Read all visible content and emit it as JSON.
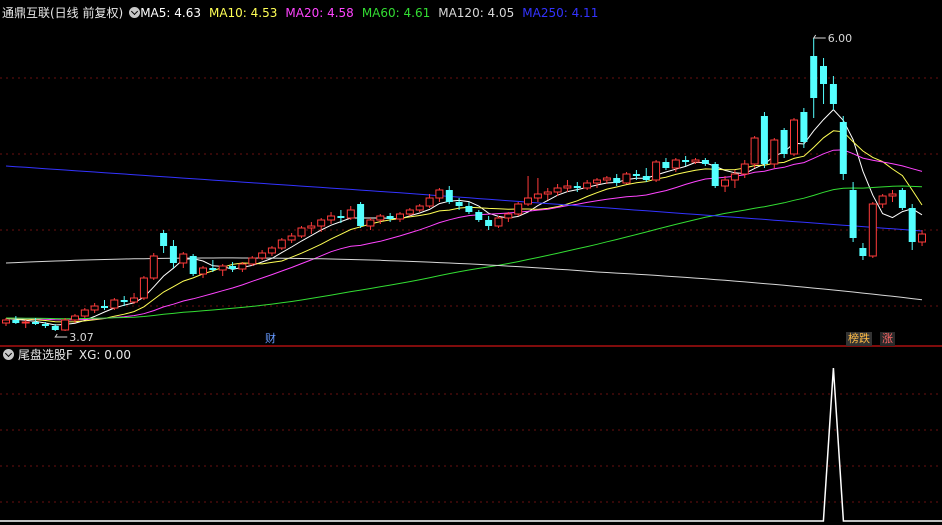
{
  "header": {
    "title": "通鼎互联(日线 前复权)",
    "ma": [
      {
        "label": "MA5: 4.63",
        "color": "#ffffff"
      },
      {
        "label": "MA10: 4.53",
        "color": "#ffff55"
      },
      {
        "label": "MA20: 4.58",
        "color": "#ff44ff"
      },
      {
        "label": "MA60: 4.61",
        "color": "#33dd33"
      },
      {
        "label": "MA120: 4.05",
        "color": "#d8d8d8"
      },
      {
        "label": "MA250: 4.11",
        "color": "#3333ff"
      }
    ]
  },
  "indicator": {
    "title": "尾盘选股F",
    "value_label": "XG: 0.00"
  },
  "badges": {
    "cai": "财",
    "bang": "榜跌",
    "zhang": "涨"
  },
  "chart_data": {
    "type": "candlestick",
    "high_label": "6.00",
    "low_label": "3.07",
    "price_range": [
      3.0,
      6.2
    ],
    "candles": [
      [
        3.15,
        3.2,
        3.12,
        3.18
      ],
      [
        3.18,
        3.22,
        3.14,
        3.15
      ],
      [
        3.15,
        3.18,
        3.1,
        3.16
      ],
      [
        3.16,
        3.2,
        3.13,
        3.14
      ],
      [
        3.14,
        3.16,
        3.1,
        3.12
      ],
      [
        3.12,
        3.14,
        3.07,
        3.08
      ],
      [
        3.08,
        3.2,
        3.07,
        3.18
      ],
      [
        3.18,
        3.24,
        3.15,
        3.22
      ],
      [
        3.22,
        3.3,
        3.2,
        3.28
      ],
      [
        3.28,
        3.35,
        3.25,
        3.32
      ],
      [
        3.32,
        3.38,
        3.28,
        3.3
      ],
      [
        3.3,
        3.4,
        3.28,
        3.38
      ],
      [
        3.38,
        3.42,
        3.32,
        3.36
      ],
      [
        3.36,
        3.45,
        3.34,
        3.4
      ],
      [
        3.4,
        3.62,
        3.38,
        3.6
      ],
      [
        3.6,
        3.85,
        3.58,
        3.82
      ],
      [
        4.05,
        4.08,
        3.85,
        3.92
      ],
      [
        3.92,
        3.98,
        3.7,
        3.75
      ],
      [
        3.75,
        3.86,
        3.7,
        3.84
      ],
      [
        3.82,
        3.84,
        3.62,
        3.64
      ],
      [
        3.64,
        3.72,
        3.6,
        3.7
      ],
      [
        3.7,
        3.78,
        3.66,
        3.68
      ],
      [
        3.68,
        3.74,
        3.62,
        3.72
      ],
      [
        3.72,
        3.76,
        3.66,
        3.69
      ],
      [
        3.69,
        3.76,
        3.66,
        3.74
      ],
      [
        3.74,
        3.82,
        3.72,
        3.8
      ],
      [
        3.8,
        3.88,
        3.78,
        3.85
      ],
      [
        3.85,
        3.92,
        3.82,
        3.9
      ],
      [
        3.9,
        4.0,
        3.88,
        3.98
      ],
      [
        3.98,
        4.05,
        3.95,
        4.02
      ],
      [
        4.02,
        4.12,
        4.0,
        4.1
      ],
      [
        4.1,
        4.16,
        4.04,
        4.12
      ],
      [
        4.12,
        4.2,
        4.06,
        4.18
      ],
      [
        4.18,
        4.26,
        4.14,
        4.22
      ],
      [
        4.22,
        4.28,
        4.15,
        4.2
      ],
      [
        4.2,
        4.32,
        4.18,
        4.28
      ],
      [
        4.34,
        4.36,
        4.1,
        4.12
      ],
      [
        4.12,
        4.2,
        4.08,
        4.18
      ],
      [
        4.18,
        4.24,
        4.14,
        4.22
      ],
      [
        4.22,
        4.25,
        4.16,
        4.19
      ],
      [
        4.19,
        4.26,
        4.16,
        4.24
      ],
      [
        4.24,
        4.3,
        4.22,
        4.28
      ],
      [
        4.28,
        4.34,
        4.26,
        4.32
      ],
      [
        4.32,
        4.44,
        4.3,
        4.4
      ],
      [
        4.4,
        4.5,
        4.36,
        4.48
      ],
      [
        4.48,
        4.52,
        4.34,
        4.36
      ],
      [
        4.36,
        4.4,
        4.28,
        4.32
      ],
      [
        4.32,
        4.36,
        4.24,
        4.26
      ],
      [
        4.26,
        4.28,
        4.16,
        4.18
      ],
      [
        4.18,
        4.22,
        4.08,
        4.12
      ],
      [
        4.12,
        4.22,
        4.1,
        4.2
      ],
      [
        4.2,
        4.26,
        4.16,
        4.24
      ],
      [
        4.24,
        4.36,
        4.22,
        4.34
      ],
      [
        4.34,
        4.62,
        4.32,
        4.4
      ],
      [
        4.4,
        4.6,
        4.36,
        4.44
      ],
      [
        4.44,
        4.5,
        4.38,
        4.46
      ],
      [
        4.46,
        4.54,
        4.42,
        4.5
      ],
      [
        4.5,
        4.58,
        4.46,
        4.52
      ],
      [
        4.52,
        4.56,
        4.46,
        4.5
      ],
      [
        4.5,
        4.58,
        4.48,
        4.55
      ],
      [
        4.55,
        4.6,
        4.5,
        4.58
      ],
      [
        4.58,
        4.62,
        4.54,
        4.6
      ],
      [
        4.6,
        4.64,
        4.52,
        4.55
      ],
      [
        4.55,
        4.66,
        4.54,
        4.64
      ],
      [
        4.64,
        4.68,
        4.58,
        4.62
      ],
      [
        4.62,
        4.7,
        4.56,
        4.58
      ],
      [
        4.58,
        4.78,
        4.56,
        4.76
      ],
      [
        4.76,
        4.8,
        4.68,
        4.7
      ],
      [
        4.7,
        4.8,
        4.66,
        4.78
      ],
      [
        4.78,
        4.82,
        4.72,
        4.76
      ],
      [
        4.76,
        4.8,
        4.74,
        4.78
      ],
      [
        4.78,
        4.8,
        4.72,
        4.74
      ],
      [
        4.74,
        4.76,
        4.5,
        4.52
      ],
      [
        4.52,
        4.62,
        4.46,
        4.58
      ],
      [
        4.58,
        4.68,
        4.5,
        4.64
      ],
      [
        4.64,
        4.78,
        4.6,
        4.74
      ],
      [
        4.74,
        5.02,
        4.7,
        5.0
      ],
      [
        5.22,
        5.26,
        4.7,
        4.74
      ],
      [
        4.74,
        5.0,
        4.7,
        4.98
      ],
      [
        5.08,
        5.1,
        4.8,
        4.84
      ],
      [
        4.84,
        5.2,
        4.82,
        5.18
      ],
      [
        5.26,
        5.3,
        4.9,
        4.96
      ],
      [
        5.82,
        6.0,
        5.2,
        5.4
      ],
      [
        5.72,
        5.8,
        5.34,
        5.54
      ],
      [
        5.54,
        5.62,
        5.28,
        5.34
      ],
      [
        5.16,
        5.22,
        4.58,
        4.64
      ],
      [
        4.48,
        4.56,
        3.96,
        4.0
      ],
      [
        3.9,
        3.95,
        3.78,
        3.82
      ],
      [
        3.82,
        4.36,
        3.8,
        4.34
      ],
      [
        4.34,
        4.44,
        4.3,
        4.42
      ],
      [
        4.42,
        4.48,
        4.36,
        4.44
      ],
      [
        4.48,
        4.5,
        4.28,
        4.3
      ],
      [
        4.3,
        4.34,
        3.88,
        3.96
      ],
      [
        3.96,
        4.08,
        3.92,
        4.04
      ]
    ],
    "indicator_xg": {
      "range": [
        0,
        1
      ],
      "spike_index": 84,
      "value": 1
    }
  }
}
